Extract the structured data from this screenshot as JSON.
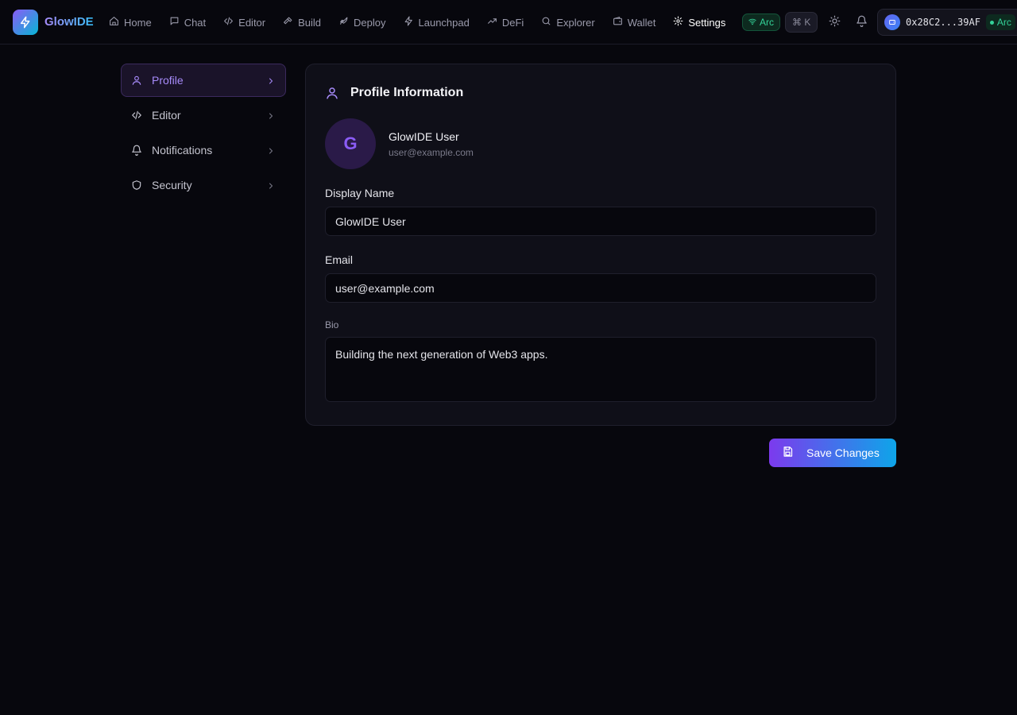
{
  "app": {
    "brand": "GlowIDE",
    "brand_colors": [
      "#8b5cf6",
      "#06b6d4"
    ]
  },
  "nav": {
    "items": [
      {
        "label": "Home",
        "icon": "home-icon"
      },
      {
        "label": "Chat",
        "icon": "chat-icon"
      },
      {
        "label": "Editor",
        "icon": "code-icon"
      },
      {
        "label": "Build",
        "icon": "hammer-icon"
      },
      {
        "label": "Deploy",
        "icon": "rocket-icon"
      },
      {
        "label": "Launchpad",
        "icon": "bolt-icon"
      },
      {
        "label": "DeFi",
        "icon": "trending-up-icon"
      },
      {
        "label": "Explorer",
        "icon": "search-icon"
      },
      {
        "label": "Wallet",
        "icon": "wallet-icon"
      },
      {
        "label": "Settings",
        "icon": "gear-icon",
        "active": true
      }
    ],
    "network_badge": "Arc",
    "shortcut": "⌘ K",
    "wallet_address": "0x28C2...39AF",
    "wallet_network": "Arc"
  },
  "sidebar": {
    "items": [
      {
        "label": "Profile",
        "icon": "user-icon",
        "active": true
      },
      {
        "label": "Editor",
        "icon": "code-icon"
      },
      {
        "label": "Notifications",
        "icon": "bell-icon"
      },
      {
        "label": "Security",
        "icon": "shield-icon"
      }
    ]
  },
  "profile": {
    "title": "Profile Information",
    "avatar_initial": "G",
    "user_name": "GlowIDE User",
    "user_email": "user@example.com",
    "display_name_label": "Display Name",
    "display_name_value": "GlowIDE User",
    "email_label": "Email",
    "email_value": "user@example.com",
    "bio_label": "Bio",
    "bio_value": "Building the next generation of Web3 apps."
  },
  "actions": {
    "save_label": "Save Changes"
  },
  "colors": {
    "background": "#07070d",
    "accent": "#a78bfa",
    "success": "#34d399"
  }
}
